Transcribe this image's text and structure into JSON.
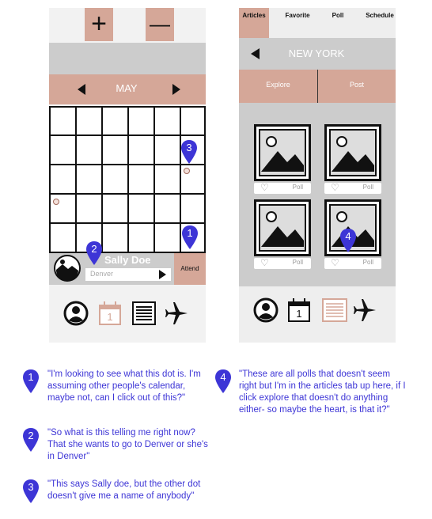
{
  "left_phone": {
    "plus_label": "+",
    "minus_label": "—",
    "month": "MAY",
    "profile_name": "Sally Doe",
    "location_placeholder": "Denver",
    "attend_label": "Attend",
    "calendar_day": "1"
  },
  "right_phone": {
    "tabs": [
      "Articles",
      "Favorite",
      "Poll",
      "Schedule"
    ],
    "city": "NEW YORK",
    "explore_label": "Explore",
    "post_label": "Post",
    "poll_labels": [
      "Poll",
      "Poll",
      "Poll",
      "Poll"
    ],
    "calendar_day": "1"
  },
  "pins": [
    "1",
    "2",
    "3",
    "4"
  ],
  "notes": [
    {
      "num": "1",
      "text": "\"I'm looking to see what this dot is. I'm assuming other people's calendar, maybe not, can I click out of this?\""
    },
    {
      "num": "2",
      "text": "\"So what is this telling me right now? That she wants to go to Denver or she's in Denver\""
    },
    {
      "num": "3",
      "text": "\"This says Sally doe, but the other dot doesn't give me a name of anybody\""
    },
    {
      "num": "4",
      "text": "\"These are all polls that doesn't seem right but I'm in the articles tab up here, if I click explore that doesn't do anything either- so maybe the heart, is that it?\""
    }
  ],
  "colors": {
    "accent": "#d5a798",
    "pin": "#3d35d6",
    "gray": "#cccccc"
  }
}
